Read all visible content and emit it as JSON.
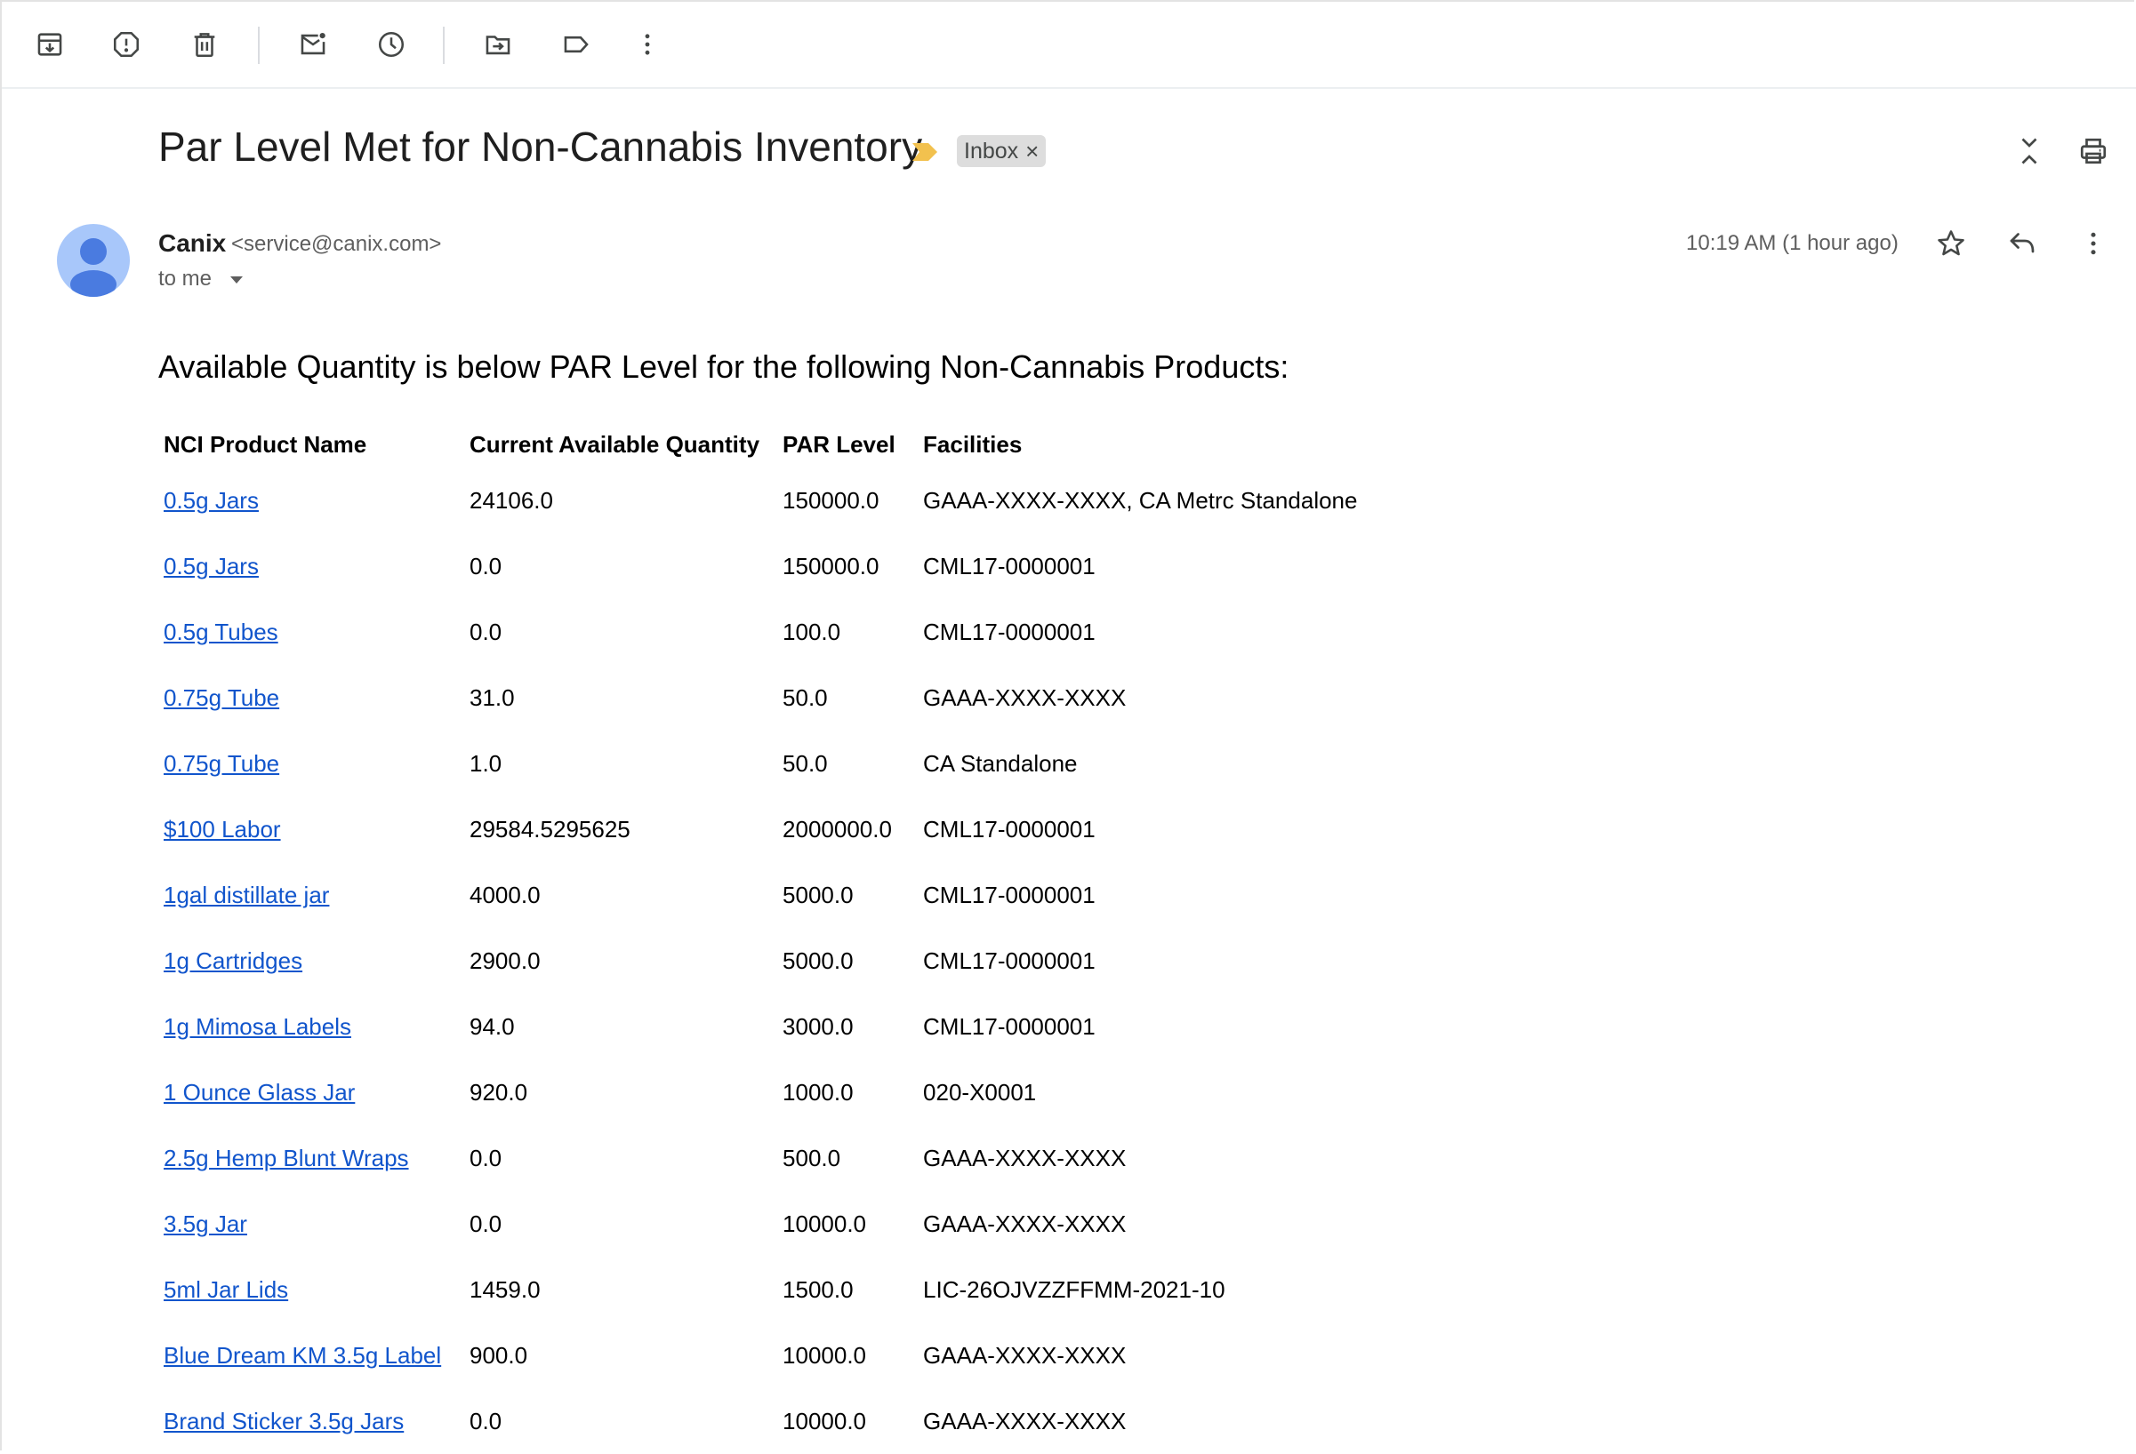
{
  "toolbar": {
    "icons": [
      "archive-icon",
      "report-spam-icon",
      "delete-icon",
      "mark-unread-icon",
      "snooze-icon",
      "move-to-icon",
      "label-icon",
      "more-vert-icon"
    ]
  },
  "message": {
    "subject": "Par Level Met for Non-Cannabis Inventory",
    "label": "Inbox",
    "label_remove": "×",
    "sender_name": "Canix",
    "sender_email": "<service@canix.com>",
    "recipient": "to me",
    "timestamp": "10:19 AM (1 hour ago)"
  },
  "body": {
    "intro": "Available Quantity is below PAR Level for the following Non-Cannabis Products:",
    "table": {
      "headers": [
        "NCI Product Name",
        "Current Available Quantity",
        "PAR Level",
        "Facilities"
      ],
      "rows": [
        {
          "name": "0.5g Jars",
          "qty": "24106.0",
          "par": "150000.0",
          "facilities": "GAAA-XXXX-XXXX, CA Metrc Standalone"
        },
        {
          "name": "0.5g Jars",
          "qty": "0.0",
          "par": "150000.0",
          "facilities": "CML17-0000001"
        },
        {
          "name": "0.5g Tubes",
          "qty": "0.0",
          "par": "100.0",
          "facilities": "CML17-0000001"
        },
        {
          "name": "0.75g Tube",
          "qty": "31.0",
          "par": "50.0",
          "facilities": "GAAA-XXXX-XXXX"
        },
        {
          "name": "0.75g Tube",
          "qty": "1.0",
          "par": "50.0",
          "facilities": "CA Standalone"
        },
        {
          "name": "$100 Labor",
          "qty": "29584.5295625",
          "par": "2000000.0",
          "facilities": "CML17-0000001"
        },
        {
          "name": "1gal distillate jar",
          "qty": "4000.0",
          "par": "5000.0",
          "facilities": "CML17-0000001"
        },
        {
          "name": "1g Cartridges",
          "qty": "2900.0",
          "par": "5000.0",
          "facilities": "CML17-0000001"
        },
        {
          "name": "1g Mimosa Labels",
          "qty": "94.0",
          "par": "3000.0",
          "facilities": "CML17-0000001"
        },
        {
          "name": "1 Ounce Glass Jar",
          "qty": "920.0",
          "par": "1000.0",
          "facilities": "020-X0001"
        },
        {
          "name": "2.5g Hemp Blunt Wraps",
          "qty": "0.0",
          "par": "500.0",
          "facilities": "GAAA-XXXX-XXXX"
        },
        {
          "name": "3.5g Jar",
          "qty": "0.0",
          "par": "10000.0",
          "facilities": "GAAA-XXXX-XXXX"
        },
        {
          "name": "5ml Jar Lids",
          "qty": "1459.0",
          "par": "1500.0",
          "facilities": "LIC-26OJVZZFFMM-2021-10"
        },
        {
          "name": "Blue Dream KM 3.5g Label",
          "qty": "900.0",
          "par": "10000.0",
          "facilities": "GAAA-XXXX-XXXX"
        },
        {
          "name": "Brand Sticker 3.5g Jars",
          "qty": "0.0",
          "par": "10000.0",
          "facilities": "GAAA-XXXX-XXXX"
        }
      ]
    }
  },
  "colors": {
    "link": "#1155cc",
    "avatar_bg": "#a8c7fa",
    "avatar_fg": "#4a7be0",
    "importance_marker": "#f2c14e",
    "label_chip_bg": "#dddddd"
  }
}
